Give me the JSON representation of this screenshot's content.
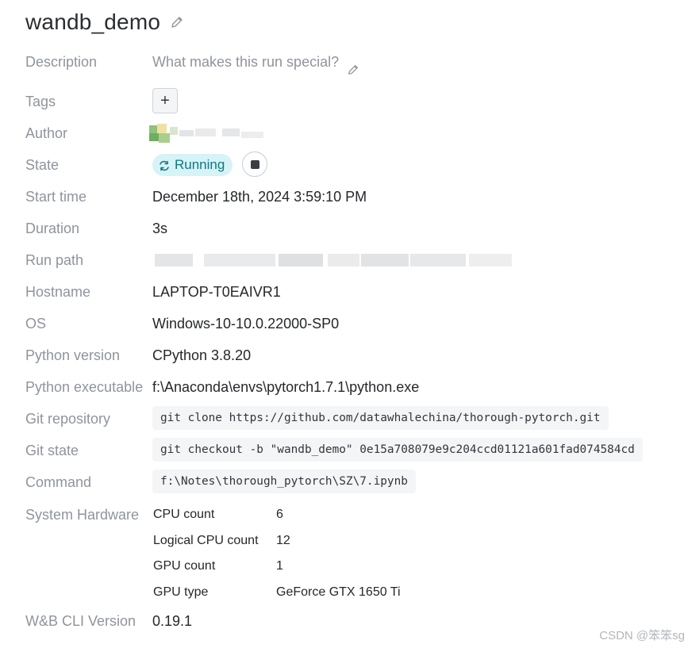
{
  "run": {
    "name": "wandb_demo"
  },
  "fields": {
    "description": {
      "label": "Description",
      "placeholder": "What makes this run special?"
    },
    "tags": {
      "label": "Tags",
      "add_label": "+"
    },
    "author": {
      "label": "Author"
    },
    "state": {
      "label": "State",
      "value": "Running",
      "pill_bg": "#d6f3f6",
      "pill_color": "#0f7884"
    },
    "start_time": {
      "label": "Start time",
      "value": "December 18th, 2024 3:59:10 PM"
    },
    "duration": {
      "label": "Duration",
      "value": "3s"
    },
    "run_path": {
      "label": "Run path"
    },
    "hostname": {
      "label": "Hostname",
      "value": "LAPTOP-T0EAIVR1"
    },
    "os": {
      "label": "OS",
      "value": "Windows-10-10.0.22000-SP0"
    },
    "python_version": {
      "label": "Python version",
      "value": "CPython 3.8.20"
    },
    "python_executable": {
      "label": "Python executable",
      "value": "f:\\Anaconda\\envs\\pytorch1.7.1\\python.exe"
    },
    "git_repository": {
      "label": "Git repository",
      "value": "git clone https://github.com/datawhalechina/thorough-pytorch.git"
    },
    "git_state": {
      "label": "Git state",
      "value": "git checkout -b \"wandb_demo\" 0e15a708079e9c204ccd01121a601fad074584cd"
    },
    "command": {
      "label": "Command",
      "value": "f:\\Notes\\thorough_pytorch\\SZ\\7.ipynb"
    },
    "system_hardware": {
      "label": "System Hardware",
      "rows": [
        {
          "key": "CPU count",
          "value": "6"
        },
        {
          "key": "Logical CPU count",
          "value": "12"
        },
        {
          "key": "GPU count",
          "value": "1"
        },
        {
          "key": "GPU type",
          "value": "GeForce GTX 1650 Ti"
        }
      ]
    },
    "cli_version": {
      "label": "W&B CLI Version",
      "value": "0.19.1"
    }
  },
  "icons": {
    "title_edit": "pencil-icon",
    "description_edit": "pencil-icon",
    "state": "sync-icon",
    "stop": "stop-icon"
  },
  "watermark": "CSDN @笨笨sg"
}
